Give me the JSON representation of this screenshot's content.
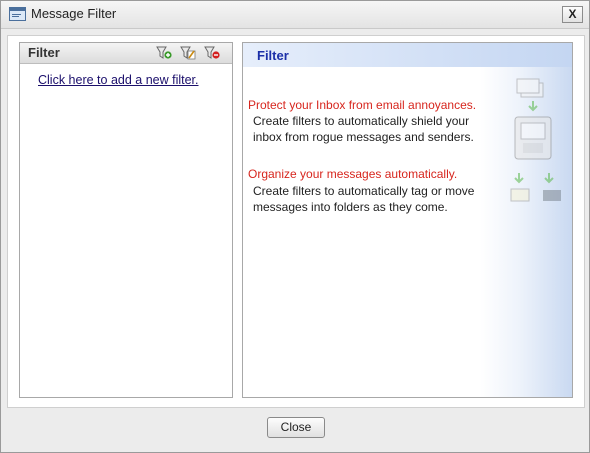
{
  "window": {
    "title": "Message Filter",
    "close_glyph": "X"
  },
  "left_panel": {
    "header": "Filter",
    "toolbar": [
      {
        "name": "add-filter-icon",
        "accent": "#3a9a2a"
      },
      {
        "name": "edit-filter-icon",
        "accent": "#c98a12"
      },
      {
        "name": "delete-filter-icon",
        "accent": "#d32020"
      }
    ],
    "add_link": "Click here to add a new filter."
  },
  "right_panel": {
    "header": "Filter",
    "sections": [
      {
        "headline": "Protect your Inbox from email annoyances.",
        "lines": [
          "Create filters to automatically shield your",
          "inbox from rogue messages and senders."
        ]
      },
      {
        "headline": "Organize your messages automatically.",
        "lines": [
          "Create filters to automatically tag or move",
          "messages into folders as they come."
        ]
      }
    ]
  },
  "footer": {
    "close_label": "Close"
  },
  "colors": {
    "headline": "#d7261e",
    "header_text": "#1b2fa8",
    "link": "#1b0f6b"
  }
}
